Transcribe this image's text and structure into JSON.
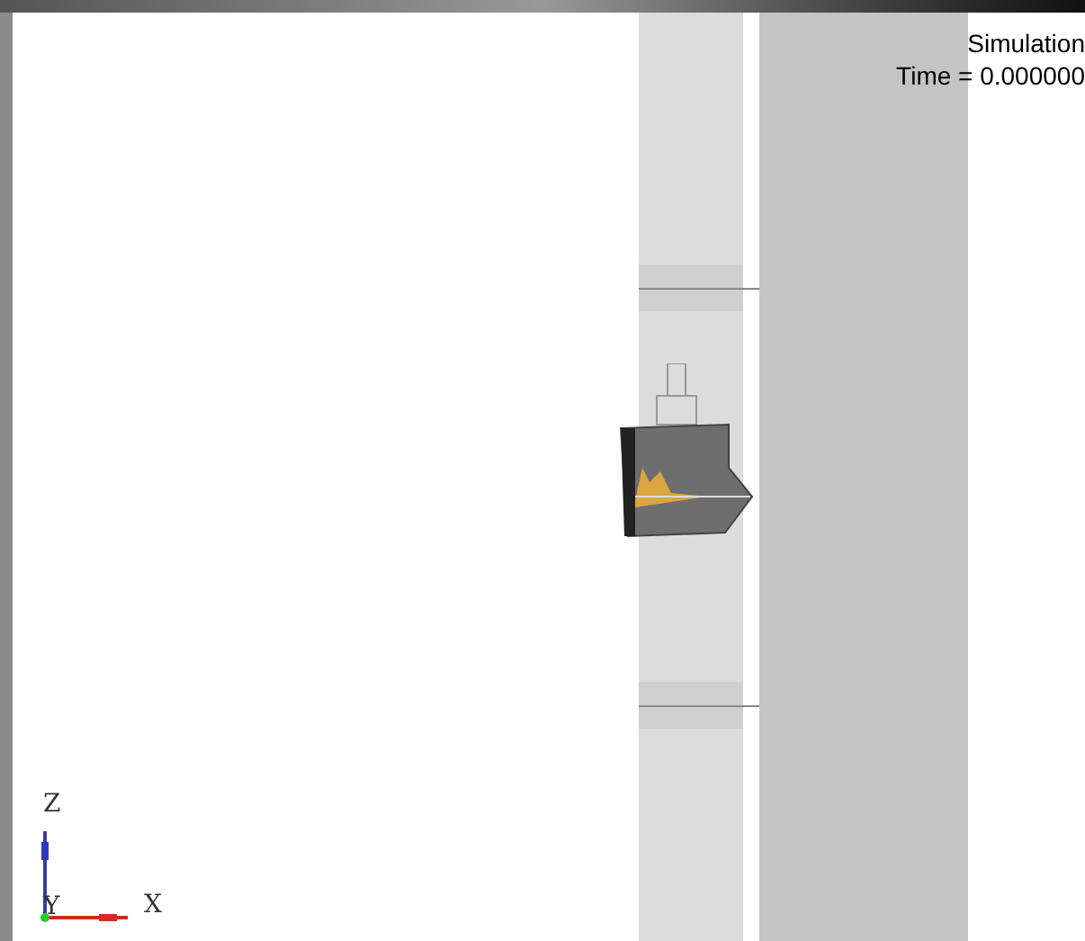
{
  "viewport": {
    "caption": [
      {
        "text": "Simulation"
      },
      {
        "text": "Time = 0.000000"
      }
    ]
  },
  "triad": {
    "axes": [
      {
        "kind": "z",
        "label": "Z"
      },
      {
        "kind": "y",
        "label": "Y"
      },
      {
        "kind": "x",
        "label": "X"
      }
    ]
  }
}
